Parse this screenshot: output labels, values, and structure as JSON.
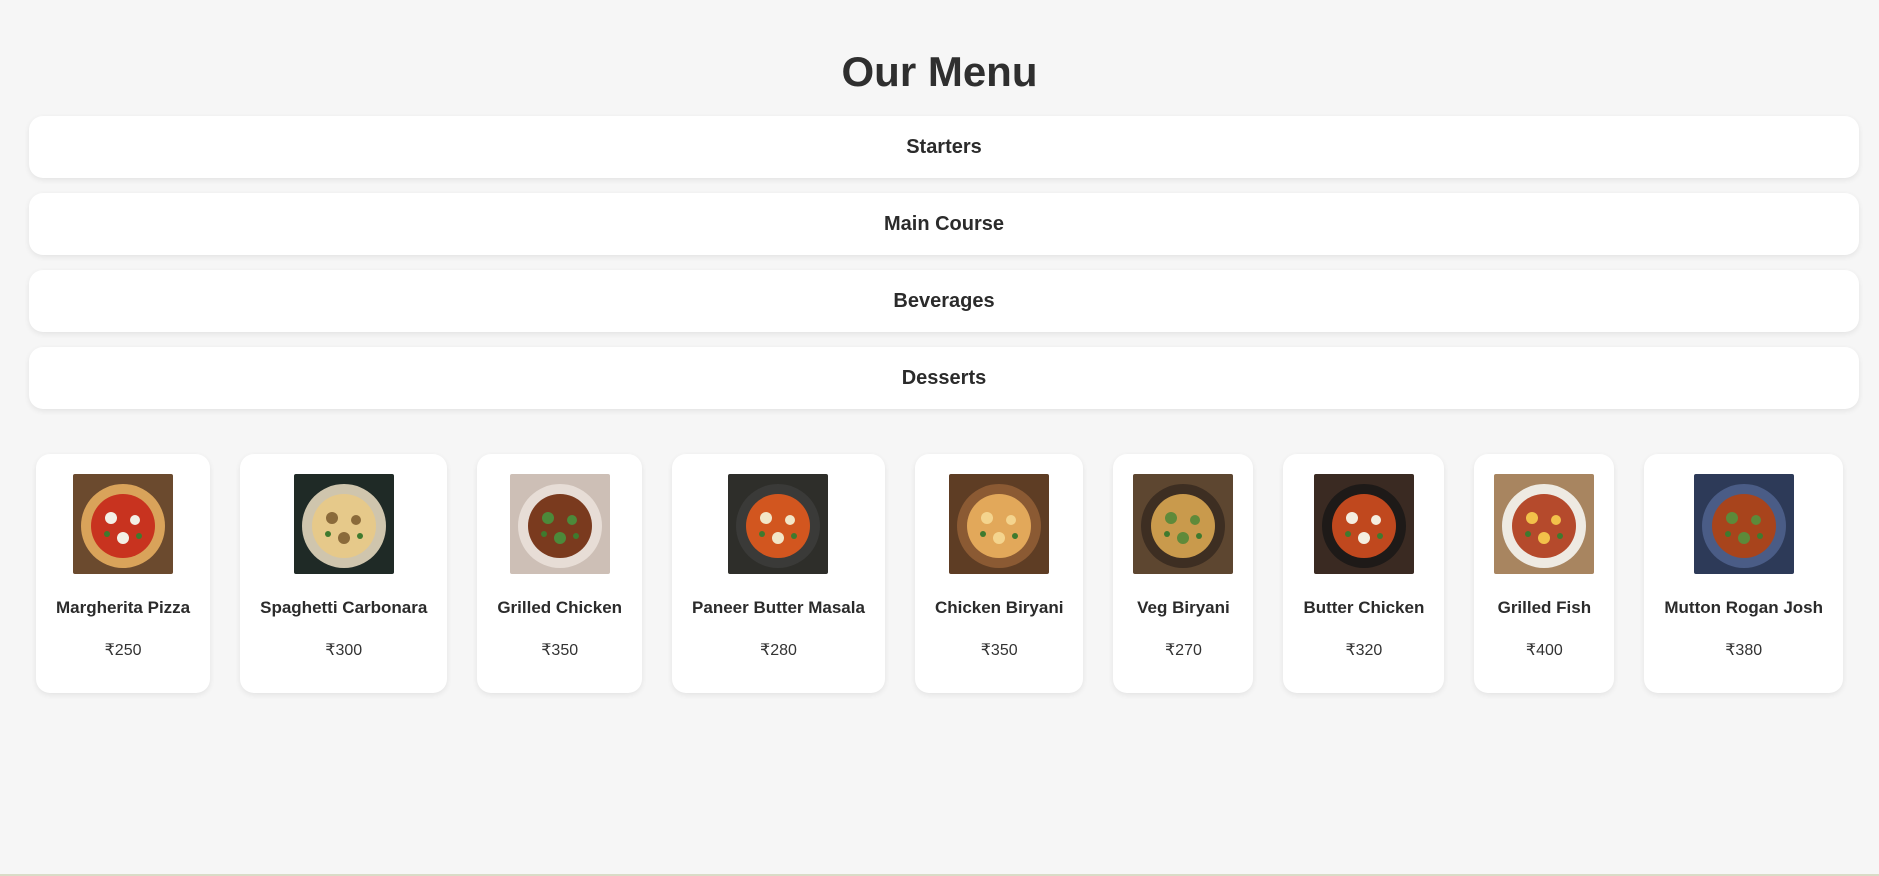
{
  "header": {
    "title": "Our Menu"
  },
  "categories": [
    {
      "label": "Starters"
    },
    {
      "label": "Main Course"
    },
    {
      "label": "Beverages"
    },
    {
      "label": "Desserts"
    }
  ],
  "items": [
    {
      "name": "Margherita Pizza",
      "price": "₹250",
      "image": "pizza",
      "bg": "#6b4a2e",
      "plate": "#d9a35a",
      "food": "#c8331f",
      "accent": "#f3f0e6"
    },
    {
      "name": "Spaghetti Carbonara",
      "price": "₹300",
      "image": "pasta",
      "bg": "#1f2a26",
      "plate": "#cfc5ad",
      "food": "#e6c98a",
      "accent": "#8a6a3a"
    },
    {
      "name": "Grilled Chicken",
      "price": "₹350",
      "image": "chicken",
      "bg": "#cdbfb6",
      "plate": "#e7ddd6",
      "food": "#7a3a1e",
      "accent": "#4c8a3a"
    },
    {
      "name": "Paneer Butter Masala",
      "price": "₹280",
      "image": "curry",
      "bg": "#2e2e2a",
      "plate": "#3a3a38",
      "food": "#d2561f",
      "accent": "#f2e6c8"
    },
    {
      "name": "Chicken Biryani",
      "price": "₹350",
      "image": "biryani",
      "bg": "#5e3d24",
      "plate": "#8b5a33",
      "food": "#e2a85a",
      "accent": "#f4d48e"
    },
    {
      "name": "Veg Biryani",
      "price": "₹270",
      "image": "vegbiryani",
      "bg": "#5d4630",
      "plate": "#3d2e22",
      "food": "#c99a4c",
      "accent": "#5f8a3a"
    },
    {
      "name": "Butter Chicken",
      "price": "₹320",
      "image": "butterchicken",
      "bg": "#3a2a22",
      "plate": "#1e1a18",
      "food": "#c0481e",
      "accent": "#f4eee0"
    },
    {
      "name": "Grilled Fish",
      "price": "₹400",
      "image": "fish",
      "bg": "#a88560",
      "plate": "#eeeae2",
      "food": "#b54a2c",
      "accent": "#f2c14a"
    },
    {
      "name": "Mutton Rogan Josh",
      "price": "₹380",
      "image": "rogan",
      "bg": "#2d3a58",
      "plate": "#4a5c86",
      "food": "#a8441c",
      "accent": "#5c8a3a"
    }
  ]
}
